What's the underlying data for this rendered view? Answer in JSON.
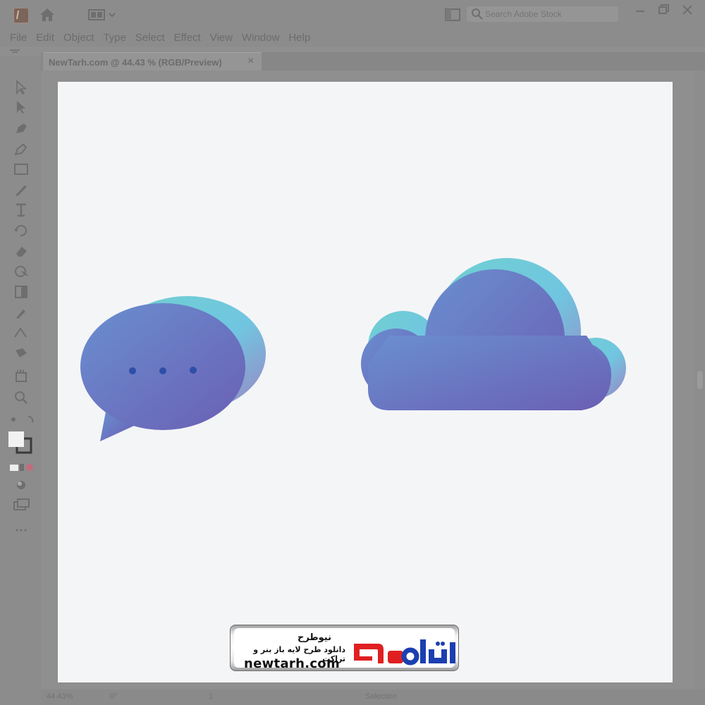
{
  "app": {
    "menu": [
      "File",
      "Edit",
      "Object",
      "Type",
      "Select",
      "Effect",
      "View",
      "Window",
      "Help"
    ],
    "search_placeholder": "Search Adobe Stock"
  },
  "document": {
    "tab_title": "NewTarh.com @ 44.43 % (RGB/Preview)",
    "close_glyph": "×"
  },
  "status": {
    "zoom": "44.43%",
    "rotation": "0°",
    "artboard_number": "1",
    "tool_name": "Selection"
  },
  "tools": [
    "selection-tool",
    "direct-selection-tool",
    "pen-tool",
    "curvature-tool",
    "rectangle-tool",
    "paintbrush-tool",
    "type-tool",
    "rotate-tool",
    "eraser-tool",
    "shape-builder-tool",
    "gradient-tool",
    "eyedropper-tool",
    "blend-tool",
    "artboard-tool",
    "zoom-tool",
    "hand-tool",
    "fill-stroke-swatch",
    "color-mode-icons",
    "draw-mode-icon",
    "screen-mode-icon",
    "more-tools-icon"
  ],
  "artwork": {
    "gradient_start": "#6a8fd0",
    "gradient_end": "#6a5fb4",
    "rim_start": "#6fd0d0",
    "rim_end": "#9b84c4",
    "dot_color": "#2f4ea8"
  },
  "watermark": {
    "name": "نیوطرح",
    "tagline": "دانلود طرح لایه باز بنر و تراکت",
    "url": "newtarh.com",
    "logo_text": "نیوطرح",
    "logo_color_red": "#e02020",
    "logo_color_blue": "#1c3fb0"
  }
}
